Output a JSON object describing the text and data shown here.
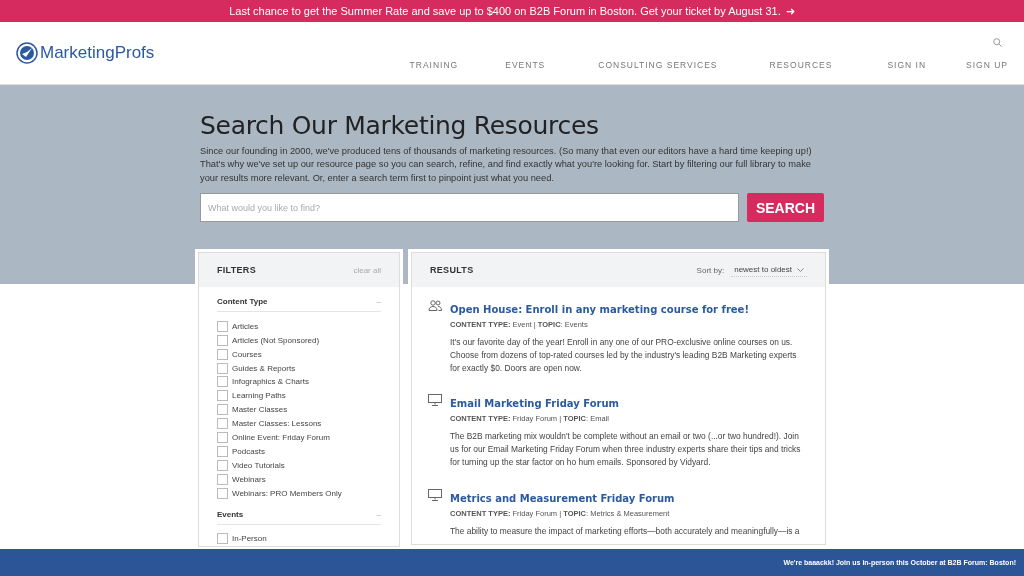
{
  "promo_banner": {
    "text": "Last chance to get the Summer Rate and save up to $400 on B2B Forum in Boston. Get your ticket by August 31.",
    "arrow": "➜"
  },
  "header": {
    "logo": "MarketingProfs",
    "nav": [
      "TRAINING",
      "EVENTS",
      "CONSULTING SERVICES",
      "RESOURCES",
      "SIGN IN",
      "SIGN UP"
    ]
  },
  "hero": {
    "title": "Search Our Marketing Resources",
    "intro": "Since our founding in 2000, we've produced tens of thousands of marketing resources. (So many that even our editors have a hard time keeping up!) That's why we've set up our resource page so you can search, refine, and find exactly what you're looking for. Start by filtering our full library to make your results more relevant. Or, enter a search term first to pinpoint just what you need.",
    "search": {
      "placeholder": "What would you like to find?",
      "button": "SEARCH"
    }
  },
  "filters": {
    "title": "FILTERS",
    "clear": "clear all",
    "groups": [
      {
        "title": "Content Type",
        "toggle": "–",
        "options": [
          {
            "label": "Articles",
            "checked": false
          },
          {
            "label": "Articles (Not Sponsored)",
            "checked": false
          },
          {
            "label": "Courses",
            "checked": false
          },
          {
            "label": "Guides & Reports",
            "checked": false
          },
          {
            "label": "Infographics & Charts",
            "checked": false
          },
          {
            "label": "Learning Paths",
            "checked": false
          },
          {
            "label": "Master Classes",
            "checked": false
          },
          {
            "label": "Master Classes: Lessons",
            "checked": false
          },
          {
            "label": "Online Event: Friday Forum",
            "checked": false
          },
          {
            "label": "Podcasts",
            "checked": false
          },
          {
            "label": "Video Tutorials",
            "checked": false
          },
          {
            "label": "Webinars",
            "checked": false
          },
          {
            "label": "Webinars: PRO Members Only",
            "checked": false
          }
        ]
      },
      {
        "title": "Events",
        "toggle": "–",
        "options": [
          {
            "label": "In-Person",
            "checked": false
          }
        ]
      }
    ]
  },
  "results": {
    "title": "RESULTS",
    "sort_label": "Sort by:",
    "sort_value": "newest to oldest",
    "items": [
      {
        "kind": "event",
        "title": "Open House: Enroll in any marketing course for free!",
        "meta": "**CONTENT TYPE:** Event | **TOPIC**: Events",
        "description": "It's our favorite day of the year! Enroll in any one of our PRO-exclusive online courses on us. Choose from dozens of top-rated courses led by the industry's leading B2B Marketing experts for exactly $0. Doors are open now."
      },
      {
        "kind": "forum",
        "title": "Email Marketing Friday Forum",
        "meta": "**CONTENT TYPE:** Friday Forum | **TOPIC**: Email",
        "description": "The B2B marketing mix wouldn't be complete without an email or two (...or two hundred!). Join us for our Email Marketing Friday Forum when three industry experts share their tips and tricks for turning up the star factor on ho hum emails. Sponsored by Vidyard."
      },
      {
        "kind": "forum",
        "title": "Metrics and Measurement Friday Forum",
        "meta": "**CONTENT TYPE:** Friday Forum | **TOPIC**: Metrics & Measurement",
        "description": "The ability to measure the impact of marketing efforts—both accurately and meaningfully—is a"
      }
    ]
  },
  "bottom_banner": {
    "text": "We're baaackk! Join us in-person this October at B2B Forum: Boston!"
  }
}
